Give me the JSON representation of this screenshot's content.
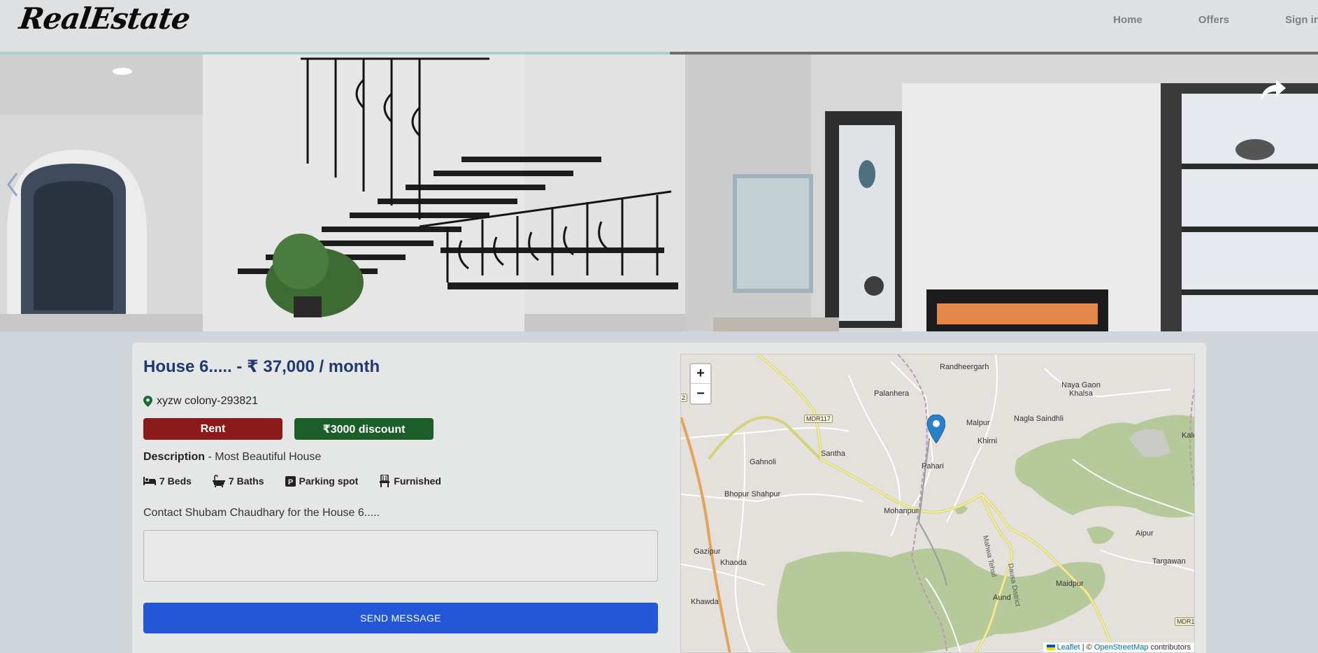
{
  "header": {
    "logo": "RealEstate",
    "nav": [
      {
        "label": "Home"
      },
      {
        "label": "Offers"
      },
      {
        "label": "Sign in"
      }
    ]
  },
  "slider": {
    "progress_fraction": 0.508,
    "share_icon": "share-arrow-icon",
    "prev_icon": "chevron-left-icon"
  },
  "listing": {
    "title": "House 6..... - ₹ 37,000 / month",
    "address": "xyzw colony-293821",
    "type_label": "Rent",
    "discount_label": "₹3000 discount",
    "description_label": "Description",
    "description_text": " - Most Beautiful House",
    "features": [
      {
        "icon": "bed-icon",
        "label": "7 Beds"
      },
      {
        "icon": "bath-icon",
        "label": "7 Baths"
      },
      {
        "icon": "parking-icon",
        "label": "Parking spot"
      },
      {
        "icon": "chair-icon",
        "label": "Furnished"
      }
    ],
    "contact_text": "Contact Shubam Chaudhary for the House 6.....",
    "message_value": "",
    "send_label": "SEND MESSAGE"
  },
  "map": {
    "zoom_in": "+",
    "zoom_out": "−",
    "places": [
      "Randheergarh",
      "Naya Gaon Khalsa",
      "Palanhera",
      "Nagla Saindhli",
      "Malpur",
      "Khirni",
      "Kalo",
      "Gahnoli",
      "Santha",
      "Pahari",
      "Bhopur Shahpur",
      "Mohanpur",
      "Aipur",
      "Gazipur",
      "Khaoda",
      "Targawan",
      "Maidpur",
      "Khawda",
      "Aund",
      "Mahwa Tehsil",
      "Dausa District"
    ],
    "road_labels": [
      "MDR117",
      "2",
      "MDR1"
    ],
    "attribution_leaflet": "Leaflet",
    "attribution_sep": " | © ",
    "attribution_osm": "OpenStreetMap",
    "attribution_tail": " contributors",
    "colors": {
      "land": "#e4e1dc",
      "forest": "#b6c99a",
      "road_major": "#f3f0a0",
      "marker": "#2a81cb"
    }
  }
}
